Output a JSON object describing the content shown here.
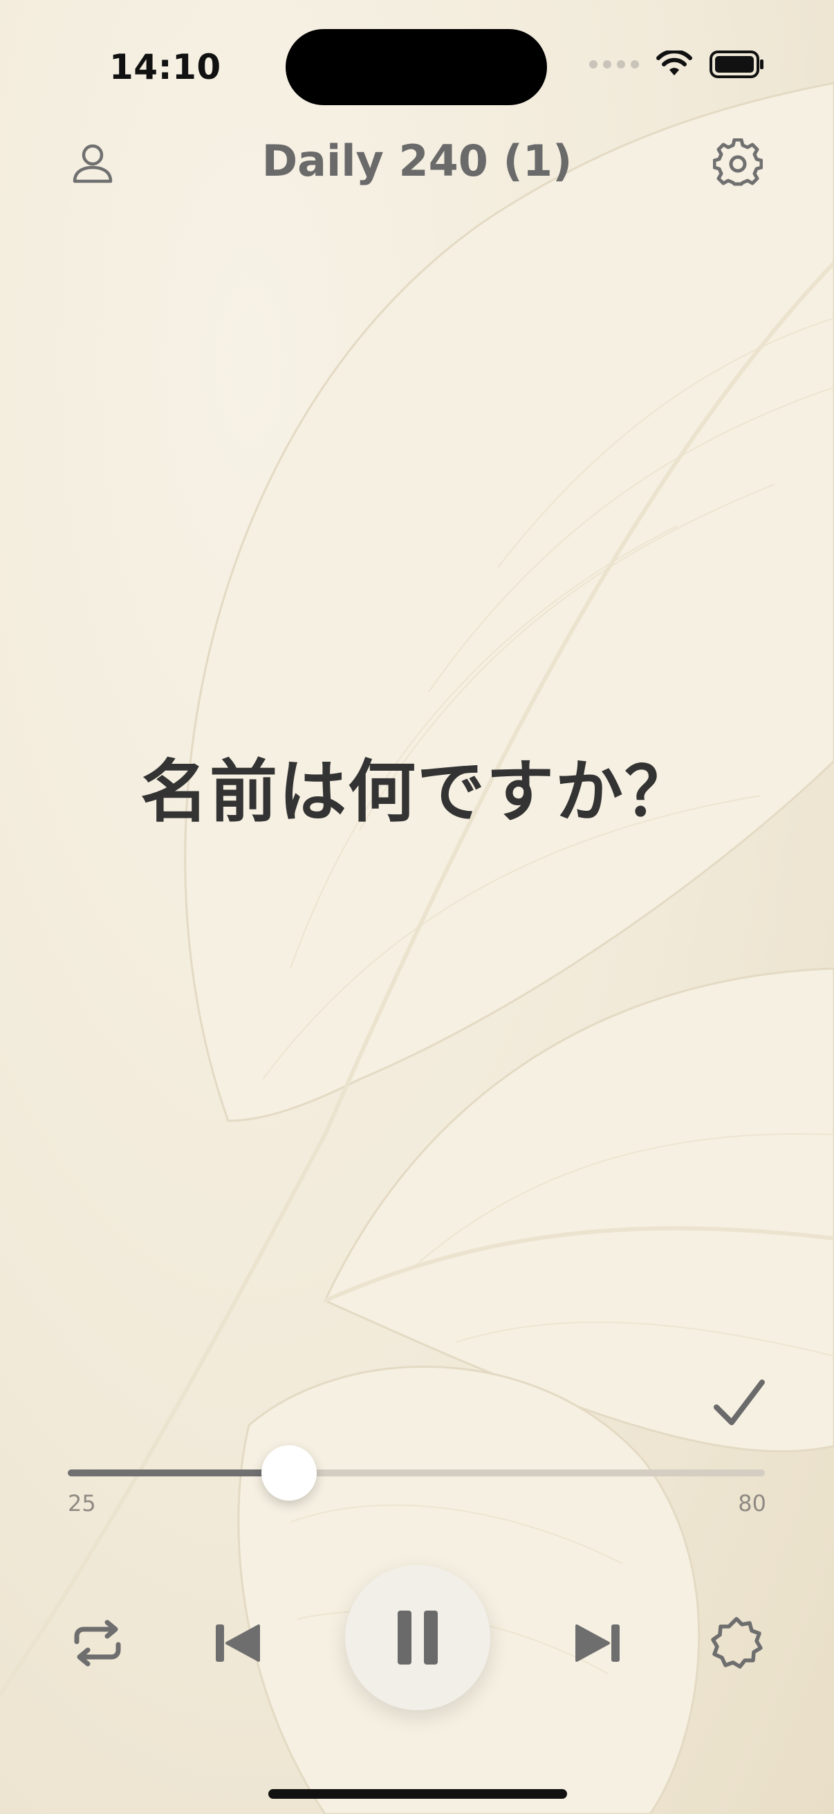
{
  "status_bar": {
    "time": "14:10"
  },
  "header": {
    "title": "Daily 240 (1)"
  },
  "main": {
    "phrase": "名前は何ですか？"
  },
  "slider": {
    "min_label": "25",
    "max_label": "80",
    "position_fraction": 0.317
  },
  "controls": {
    "icons": [
      "repeat-icon",
      "skip-back-icon",
      "pause-icon",
      "skip-forward-icon",
      "settings-badge-icon"
    ]
  },
  "colors": {
    "background": "#f1ead9",
    "title_text": "#6a6a6a",
    "phrase_text": "#333333",
    "icon": "#6e6e6e"
  }
}
